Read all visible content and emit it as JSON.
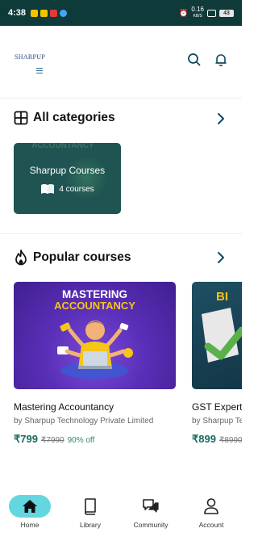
{
  "status_bar": {
    "time": "4:38",
    "speed_value": "0.16",
    "speed_unit": "KB/S",
    "battery": "43"
  },
  "header": {
    "logo_text": "SHARPUP"
  },
  "categories_section": {
    "title": "All categories",
    "card": {
      "bg_text": "ACCOUNTANCY",
      "title": "Sharpup Courses",
      "count": "4 courses"
    }
  },
  "popular_section": {
    "title": "Popular courses",
    "courses": [
      {
        "thumb_line1": "MASTERING",
        "thumb_line2": "ACCOUNTANCY",
        "name": "Mastering Accountancy",
        "org": "by Sharpup Technology Private Limited",
        "price": "₹799",
        "mrp": "₹7990",
        "off": "90% off"
      },
      {
        "thumb_line1": "BI",
        "name": "GST Expert",
        "org": "by Sharpup Te",
        "price": "₹899",
        "mrp": "₹8990"
      }
    ]
  },
  "bottom_nav": {
    "items": [
      {
        "label": "Home",
        "icon": "home-icon"
      },
      {
        "label": "Library",
        "icon": "book-icon"
      },
      {
        "label": "Community",
        "icon": "chat-icon"
      },
      {
        "label": "Account",
        "icon": "person-icon"
      }
    ]
  },
  "colors": {
    "status_bar_bg": "#0f3a3a",
    "brand_teal": "#1f5452",
    "price_green": "#1a6b5f",
    "nav_active": "#63d6e0",
    "icon_teal": "#0f4a5e"
  }
}
